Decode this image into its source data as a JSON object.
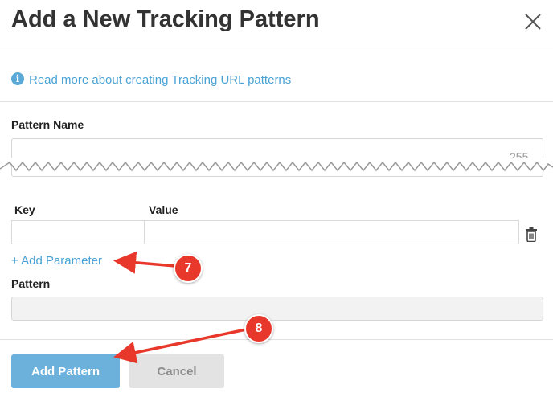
{
  "dialog": {
    "title": "Add a New Tracking Pattern",
    "close_icon": "close-icon"
  },
  "info": {
    "icon": "info-icon",
    "link_text": "Read more about creating Tracking URL patterns"
  },
  "pattern_name": {
    "label": "Pattern Name",
    "value": "",
    "char_count": "255"
  },
  "parameters": {
    "columns": [
      "Key",
      "Value"
    ],
    "rows": [
      {
        "key": "",
        "value": ""
      }
    ],
    "delete_icon": "trash-icon",
    "add_label": "+ Add Parameter"
  },
  "pattern": {
    "label": "Pattern",
    "value": ""
  },
  "buttons": {
    "add_pattern": "Add Pattern",
    "cancel": "Cancel"
  },
  "annotations": {
    "step_7": "7",
    "step_8": "8",
    "color": "#e8382b"
  },
  "colors": {
    "link": "#4aa3d4",
    "primary_button": "#6bb1dc",
    "secondary_button": "#e3e3e3"
  }
}
